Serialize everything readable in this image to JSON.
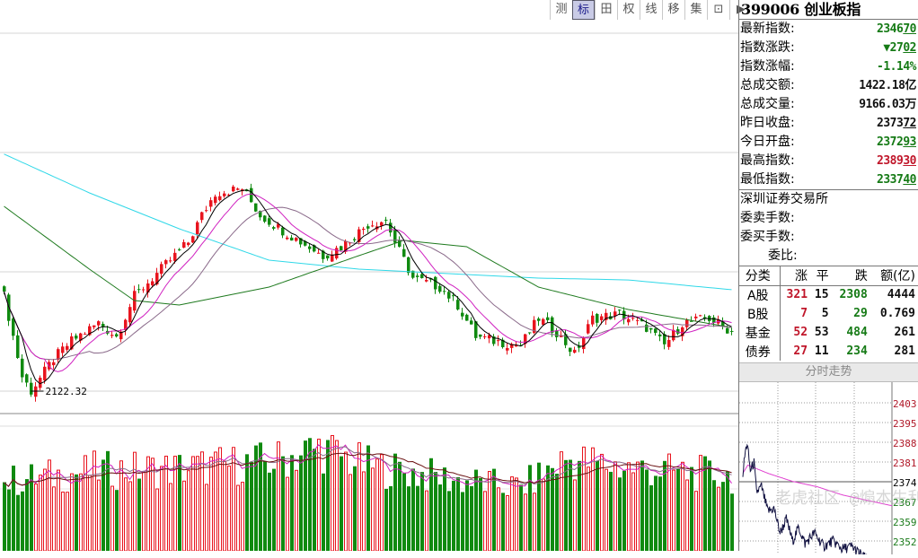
{
  "toolbar": {
    "buttons": [
      "测",
      "标",
      "田",
      "权",
      "线",
      "移",
      "集",
      "⊡",
      "▶"
    ],
    "active": 1
  },
  "quote": {
    "title": "399006 创业板指",
    "rows": [
      {
        "label": "最新指数:",
        "main": "2346",
        "under": "70",
        "color": "g"
      },
      {
        "label": "指数涨跌:",
        "main": "▼27",
        "under": "02",
        "color": "g"
      },
      {
        "label": "指数涨幅:",
        "main": "-1.14%",
        "under": "",
        "color": "g"
      },
      {
        "label": "总成交额:",
        "main": "1422.18亿",
        "under": "",
        "color": "k"
      },
      {
        "label": "总成交量:",
        "main": "9166.03万",
        "under": "",
        "color": "k"
      },
      {
        "label": "昨日收盘:",
        "main": "2373",
        "under": "72",
        "color": "k"
      },
      {
        "label": "今日开盘:",
        "main": "2372",
        "under": "93",
        "color": "g"
      },
      {
        "label": "最高指数:",
        "main": "2389",
        "under": "30",
        "color": "r"
      },
      {
        "label": "最低指数:",
        "main": "2337",
        "under": "40",
        "color": "g"
      }
    ],
    "exchange": "深圳证券交易所",
    "sell_label": "委卖手数:",
    "buy_label": "委买手数:",
    "ratio_label": "委比:"
  },
  "breadth": {
    "headers": [
      "分类",
      "涨",
      "平",
      "跌",
      "额(亿)"
    ],
    "rows": [
      [
        "A股",
        "321",
        "15",
        "2308",
        "4444"
      ],
      [
        "B股",
        "7",
        "5",
        "29",
        "0.769"
      ],
      [
        "基金",
        "52",
        "53",
        "484",
        "261"
      ],
      [
        "债券",
        "27",
        "11",
        "234",
        "281"
      ]
    ]
  },
  "intraday_title": "分时走势",
  "watermark": "老虎社区 @煽本生利",
  "colors": {
    "up": "#e8141e",
    "down": "#108a10",
    "ma5": "#000000",
    "ma10": "#d020c0",
    "ma20": "#8a6a8a",
    "ma60": "#1e7a1e",
    "ma250": "#30d8e8",
    "avg": "#e040d0"
  },
  "chart_data": [
    {
      "type": "candlestick",
      "title": "创业板指 日K",
      "low_label": "2122.32",
      "ylim": [
        2040,
        3536
      ],
      "close_keypoints": [
        [
          0,
          2482
        ],
        [
          4,
          2176
        ],
        [
          6,
          2122
        ],
        [
          11,
          2244
        ],
        [
          15,
          2312
        ],
        [
          21,
          2380
        ],
        [
          25,
          2329
        ],
        [
          29,
          2482
        ],
        [
          33,
          2550
        ],
        [
          37,
          2618
        ],
        [
          41,
          2686
        ],
        [
          44,
          2788
        ],
        [
          47,
          2873
        ],
        [
          53,
          2890
        ],
        [
          57,
          2788
        ],
        [
          63,
          2720
        ],
        [
          71,
          2635
        ],
        [
          75,
          2669
        ],
        [
          81,
          2754
        ],
        [
          85,
          2771
        ],
        [
          87,
          2686
        ],
        [
          91,
          2550
        ],
        [
          97,
          2516
        ],
        [
          101,
          2448
        ],
        [
          105,
          2329
        ],
        [
          109,
          2312
        ],
        [
          115,
          2295
        ],
        [
          119,
          2397
        ],
        [
          123,
          2346
        ],
        [
          127,
          2261
        ],
        [
          131,
          2397
        ],
        [
          137,
          2414
        ],
        [
          143,
          2363
        ],
        [
          147,
          2295
        ],
        [
          151,
          2380
        ],
        [
          157,
          2397
        ],
        [
          162,
          2347
        ]
      ],
      "ma60_keypoints": [
        [
          0,
          2822
        ],
        [
          19,
          2584
        ],
        [
          29,
          2465
        ],
        [
          39,
          2448
        ],
        [
          59,
          2516
        ],
        [
          79,
          2635
        ],
        [
          89,
          2693
        ],
        [
          103,
          2669
        ],
        [
          119,
          2516
        ],
        [
          139,
          2431
        ],
        [
          162,
          2363
        ]
      ],
      "ma250_keypoints": [
        [
          0,
          3020
        ],
        [
          19,
          2873
        ],
        [
          39,
          2737
        ],
        [
          59,
          2618
        ],
        [
          79,
          2584
        ],
        [
          99,
          2567
        ],
        [
          119,
          2550
        ],
        [
          139,
          2543
        ],
        [
          162,
          2506
        ]
      ],
      "volume_keypoints": [
        [
          0,
          60
        ],
        [
          20,
          70
        ],
        [
          40,
          72
        ],
        [
          60,
          78
        ],
        [
          70,
          90
        ],
        [
          80,
          75
        ],
        [
          100,
          62
        ],
        [
          115,
          55
        ],
        [
          125,
          80
        ],
        [
          140,
          72
        ],
        [
          162,
          65
        ]
      ]
    },
    {
      "type": "line",
      "title": "分时走势",
      "prev_close": 2373.72,
      "ylim": [
        2345,
        2410
      ],
      "y_ticks": [
        "2403",
        "2395",
        "2388",
        "2381",
        "2374",
        "2367",
        "2359",
        "2352"
      ],
      "price_keypoints": [
        [
          0,
          2377
        ],
        [
          4,
          2385
        ],
        [
          7,
          2388
        ],
        [
          12,
          2378
        ],
        [
          18,
          2381
        ],
        [
          22,
          2370
        ],
        [
          30,
          2372
        ],
        [
          40,
          2363
        ],
        [
          50,
          2364
        ],
        [
          60,
          2355
        ],
        [
          70,
          2360
        ],
        [
          80,
          2352
        ],
        [
          90,
          2357
        ],
        [
          100,
          2351
        ],
        [
          115,
          2355
        ],
        [
          130,
          2350
        ],
        [
          145,
          2352
        ],
        [
          160,
          2349
        ],
        [
          175,
          2350
        ],
        [
          190,
          2347
        ],
        [
          200,
          2345
        ]
      ],
      "avg_keypoints": [
        [
          0,
          2377
        ],
        [
          8,
          2380
        ],
        [
          40,
          2377
        ],
        [
          80,
          2374
        ],
        [
          120,
          2372
        ],
        [
          160,
          2369
        ],
        [
          200,
          2367
        ],
        [
          240,
          2365
        ]
      ]
    }
  ]
}
